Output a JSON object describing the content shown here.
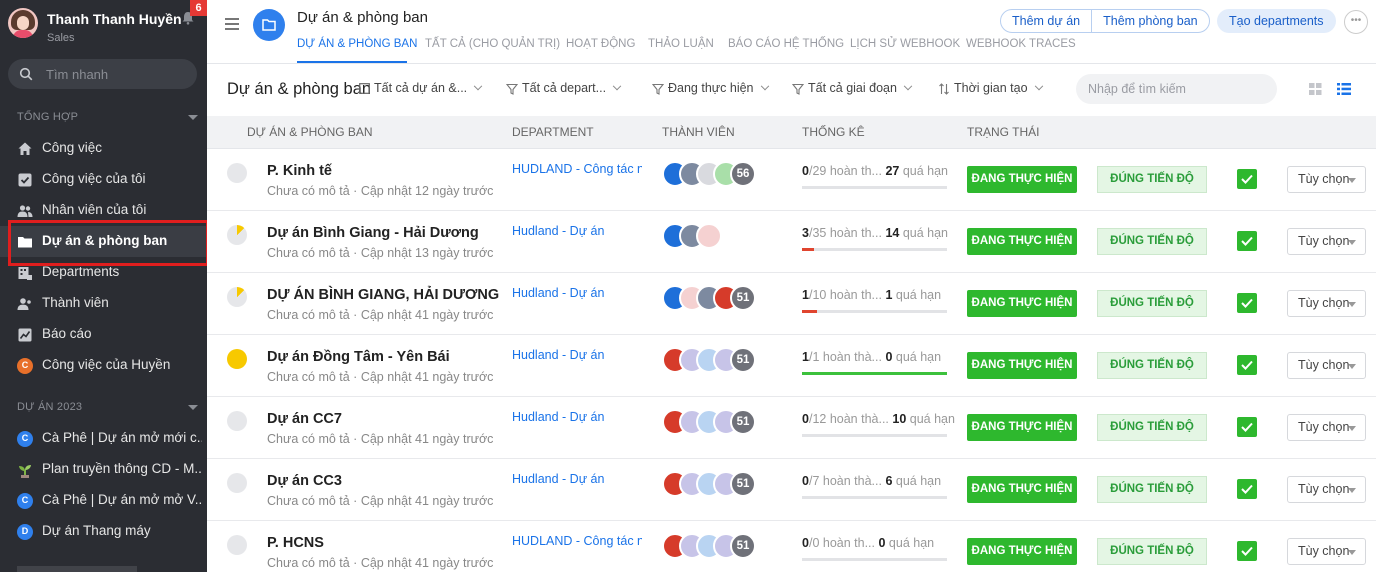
{
  "user": {
    "name": "Thanh Thanh Huyền",
    "role": "Sales",
    "notifications": "6"
  },
  "sidebar": {
    "search_placeholder": "Tìm nhanh",
    "section_general": "TỔNG HỢP",
    "items": [
      {
        "label": "Công việc",
        "icon": "home-icon"
      },
      {
        "label": "Công việc của tôi",
        "icon": "checkbox-icon"
      },
      {
        "label": "Nhân viên của tôi",
        "icon": "people-icon"
      },
      {
        "label": "Dự án & phòng ban",
        "icon": "folder-icon",
        "active": true
      },
      {
        "label": "Departments",
        "icon": "departments-icon"
      },
      {
        "label": "Thành viên",
        "icon": "members-icon"
      },
      {
        "label": "Báo cáo",
        "icon": "chart-icon"
      },
      {
        "label": "Công việc của Huyền",
        "icon": "letter-c-icon",
        "letter": "C",
        "color": "#e8702a"
      }
    ],
    "section_projects": "DỰ ÁN 2023",
    "projects": [
      {
        "label": "Cà Phê | Dự án mở mới c...",
        "letter": "C",
        "color": "#2f80ed"
      },
      {
        "label": "Plan truyền thông CD - M...",
        "icon": "plant-icon"
      },
      {
        "label": "Cà Phê | Dự án mở mở V...",
        "letter": "C",
        "color": "#2f80ed"
      },
      {
        "label": "Dự án Thang máy",
        "letter": "D",
        "color": "#2f80ed"
      }
    ]
  },
  "header": {
    "title": "Dự án & phòng ban",
    "tabs": [
      "DỰ ÁN & PHÒNG BAN",
      "TẤT CẢ (CHO QUẢN TRỊ)",
      "HOẠT ĐỘNG",
      "THẢO LUẬN",
      "BÁO CÁO HỆ THỐNG",
      "LỊCH SỬ WEBHOOK",
      "WEBHOOK TRACES"
    ],
    "btn_add_project": "Thêm dự án",
    "btn_add_department": "Thêm phòng ban",
    "btn_create_departments": "Tạo departments",
    "more": "•••"
  },
  "toolbar": {
    "title": "Dự án & phòng ban",
    "filter_projects": "Tất cả dự án &...",
    "filter_departments": "Tất cả depart...",
    "filter_status": "Đang thực hiện",
    "filter_phase": "Tất cả giai đoạn",
    "sort_time": "Thời gian tạo",
    "search_placeholder": "Nhập để tìm kiếm"
  },
  "table": {
    "headers": [
      "DỰ ÁN & PHÒNG BAN",
      "DEPARTMENT",
      "THÀNH VIÊN",
      "THỐNG KÊ",
      "TRẠNG THÁI"
    ],
    "done_label": "hoàn th...",
    "done_label_alt": "hoàn thà...",
    "overdue_label": "quá hạn",
    "status_label": "ĐANG THỰC HIỆN",
    "ontime_label": "ĐÚNG TIẾN ĐỘ",
    "option_label": "Tùy chọn",
    "rows": [
      {
        "name": "P. Kinh tế",
        "meta": "Chưa có mô tả · Cập nhật 12 ngày trước",
        "dept": "HUDLAND - Công tác nội",
        "member_count": "56",
        "done": "0",
        "total": "29",
        "overdue": "27",
        "done_text": "hoàn th...",
        "progress": 0,
        "dot": "grey",
        "avatars": [
          "blue",
          "photo",
          "grey",
          "green"
        ]
      },
      {
        "name": "Dự án Bình Giang - Hải Dương",
        "meta": "Chưa có mô tả · Cập nhật 13 ngày trước",
        "dept": "Hudland - Dự án",
        "member_count": "",
        "done": "3",
        "total": "35",
        "overdue": "14",
        "done_text": "hoàn th...",
        "progress": 0.0857,
        "dot": "partial",
        "avatars": [
          "blue",
          "photo",
          "pink"
        ]
      },
      {
        "name": "DỰ ÁN BÌNH GIANG, HẢI DƯƠNG",
        "meta": "Chưa có mô tả · Cập nhật 41 ngày trước",
        "dept": "Hudland - Dự án",
        "member_count": "51",
        "done": "1",
        "total": "10",
        "overdue": "1",
        "done_text": "hoàn th...",
        "progress": 0.1,
        "dot": "partial",
        "avatars": [
          "blue",
          "pink",
          "photo",
          "red"
        ]
      },
      {
        "name": "Dự án Đồng Tâm - Yên Bái",
        "meta": "Chưa có mô tả · Cập nhật 41 ngày trước",
        "dept": "Hudland - Dự án",
        "member_count": "51",
        "done": "1",
        "total": "1",
        "overdue": "0",
        "done_text": "hoàn thà...",
        "progress": 1,
        "dot": "yellow",
        "avatars": [
          "red",
          "lav",
          "lblue",
          "lav"
        ]
      },
      {
        "name": "Dự án CC7",
        "meta": "Chưa có mô tả · Cập nhật 41 ngày trước",
        "dept": "Hudland - Dự án",
        "member_count": "51",
        "done": "0",
        "total": "12",
        "overdue": "10",
        "done_text": "hoàn thà...",
        "progress": 0,
        "dot": "grey",
        "avatars": [
          "red",
          "lav",
          "lblue",
          "lav"
        ]
      },
      {
        "name": "Dự án CC3",
        "meta": "Chưa có mô tả · Cập nhật 41 ngày trước",
        "dept": "Hudland - Dự án",
        "member_count": "51",
        "done": "0",
        "total": "7",
        "overdue": "6",
        "done_text": "hoàn thà...",
        "progress": 0,
        "dot": "grey",
        "avatars": [
          "red",
          "lav",
          "lblue",
          "lav"
        ]
      },
      {
        "name": "P. HCNS",
        "meta": "Chưa có mô tả · Cập nhật 41 ngày trước",
        "dept": "HUDLAND - Công tác nội",
        "member_count": "51",
        "done": "0",
        "total": "0",
        "overdue": "0",
        "done_text": "hoàn th...",
        "progress": 0,
        "dot": "grey",
        "avatars": [
          "red",
          "lav",
          "lblue",
          "lav"
        ]
      }
    ]
  },
  "colors": {
    "accent": "#1a73e8",
    "status_green": "#2eb82e",
    "sidebar_bg": "#2b2d33",
    "highlight": "#e01e1e"
  }
}
